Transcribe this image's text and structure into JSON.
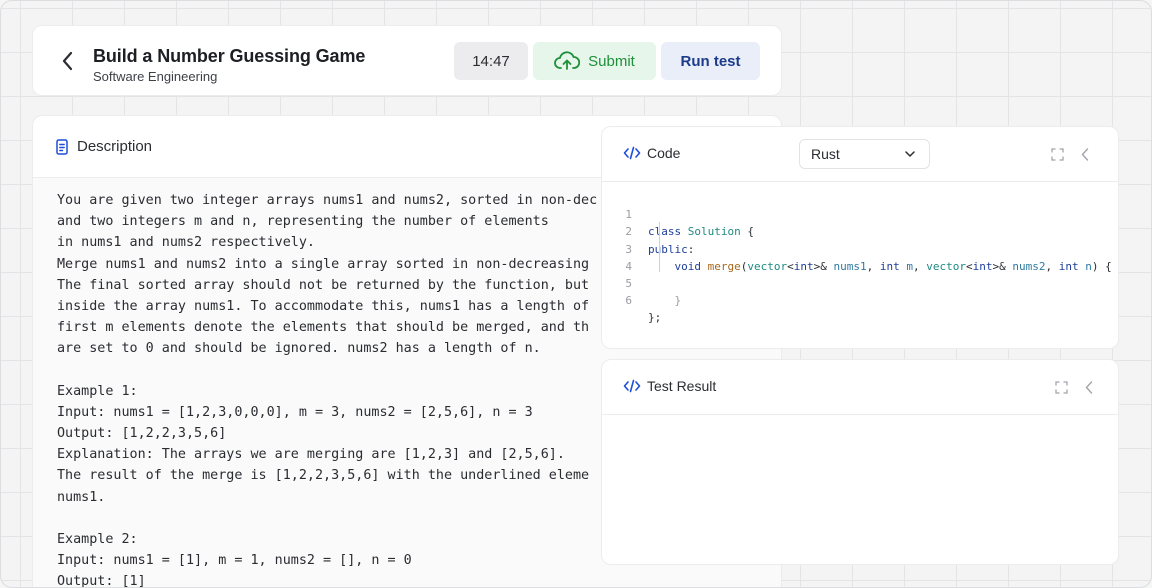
{
  "header": {
    "title": "Build a Number Guessing Game",
    "subtitle": "Software Engineering",
    "timer": "14:47",
    "submit_label": "Submit",
    "run_label": "Run test"
  },
  "description": {
    "title": "Description",
    "lines": [
      "You are given two integer arrays nums1 and nums2, sorted in non-dec",
      "and two integers m and n, representing the number of elements",
      "in nums1 and nums2 respectively.",
      "Merge nums1 and nums2 into a single array sorted in non-decreasing",
      "The final sorted array should not be returned by the function, but",
      "inside the array nums1. To accommodate this, nums1 has a length of",
      "first m elements denote the elements that should be merged, and th",
      "are set to 0 and should be ignored. nums2 has a length of n.",
      "",
      "Example 1:",
      "Input: nums1 = [1,2,3,0,0,0], m = 3, nums2 = [2,5,6], n = 3",
      "Output: [1,2,2,3,5,6]",
      "Explanation: The arrays we are merging are [1,2,3] and [2,5,6].",
      "The result of the merge is [1,2,2,3,5,6] with the underlined eleme",
      "nums1.",
      "",
      "Example 2:",
      "Input: nums1 = [1], m = 1, nums2 = [], n = 0",
      "Output: [1]"
    ]
  },
  "code_panel": {
    "title": "Code",
    "language": "Rust",
    "line_numbers": [
      "1",
      "2",
      "3",
      "4",
      "5",
      "6"
    ],
    "lines": [
      "class Solution {",
      "public:",
      "    void merge(vector<int>& nums1, int m, vector<int>& nums2, int n) {",
      "",
      "    }",
      "};"
    ]
  },
  "result_panel": {
    "title": "Test Result"
  },
  "colors": {
    "submit_green": "#1f8f3a",
    "run_blue": "#1d3b8a",
    "accent_blue": "#1d4fd8"
  },
  "icons": {
    "back": "chevron-left-icon",
    "submit": "cloud-upload-icon",
    "description": "document-icon",
    "code": "code-icon",
    "select": "chevron-down-icon",
    "expand": "expand-icon",
    "collapse": "chevron-left-icon"
  }
}
